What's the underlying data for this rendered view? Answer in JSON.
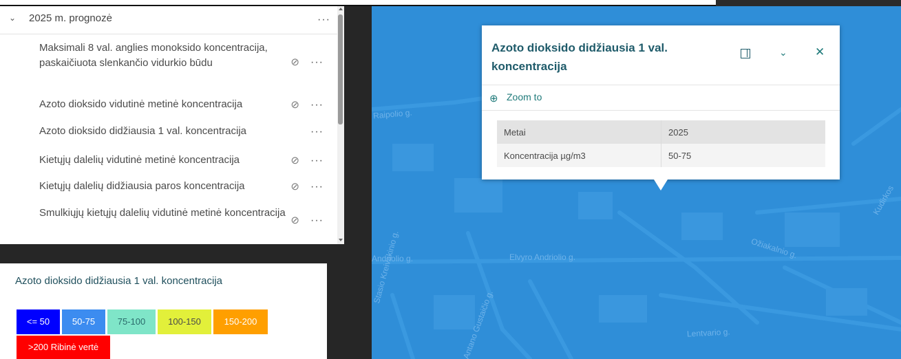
{
  "layer_list": {
    "group_title": "2025 m. prognozė",
    "layers": [
      {
        "label": "Maksimali 8 val. anglies monoksido koncentracija, paskaičiuota slenkančio vidurkio būdu",
        "hidden": true
      },
      {
        "label": "Azoto dioksido vidutinė metinė koncentracija",
        "hidden": true
      },
      {
        "label": "Azoto dioksido didžiausia 1 val. koncentracija",
        "hidden": false
      },
      {
        "label": "Kietųjų dalelių vidutinė metinė koncentracija",
        "hidden": true
      },
      {
        "label": "Kietųjų dalelių didžiausia paros koncentracija",
        "hidden": true
      },
      {
        "label": "Smulkiųjų kietųjų dalelių vidutinė metinė koncentracija",
        "hidden": true
      }
    ],
    "options_glyph": "···",
    "hidden_glyph": "⊘"
  },
  "legend": {
    "title": "Azoto dioksido didžiausia 1 val. koncentracija",
    "classes": [
      {
        "label": "<= 50",
        "color": "#0000ff",
        "text_color": "#ffffff"
      },
      {
        "label": "50-75",
        "color": "#3c8cf0",
        "text_color": "#ffffff"
      },
      {
        "label": "75-100",
        "color": "#7fe5c8",
        "text_color": "#2a6a6a"
      },
      {
        "label": "100-150",
        "color": "#e2f03a",
        "text_color": "#4a4a4a"
      },
      {
        "label": "150-200",
        "color": "#ff9f00",
        "text_color": "#ffffff"
      },
      {
        "label": ">200 Ribinė vertė",
        "color": "#ff0000",
        "text_color": "#ffffff"
      }
    ]
  },
  "popup": {
    "title": "Azoto dioksido didžiausia 1 val. koncentracija",
    "zoom_label": "Zoom to",
    "fields": [
      {
        "key": "Metai",
        "value": "2025"
      },
      {
        "key": "Koncentracija µg/m3",
        "value": "50-75"
      }
    ]
  },
  "map": {
    "background": "#2f8ed8",
    "streets": [
      "Raipolio g.",
      "Andriolio g.",
      "Elvyro Andriolio g.",
      "Ožiakalnio g.",
      "Lentvario g.",
      "Kudirkos",
      "Stasio Kreivakinio g.",
      "Antano Gustaičio g."
    ]
  }
}
